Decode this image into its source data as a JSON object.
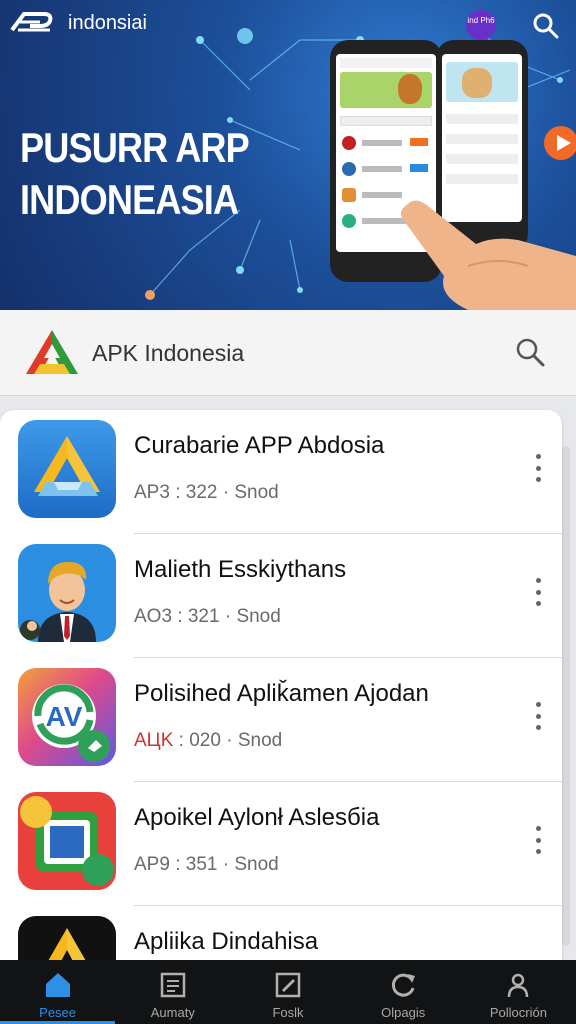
{
  "hero": {
    "brand_name": "indonsiai",
    "badge_text": "ind Ph6",
    "title_line1": "PUSURR ARP",
    "title_line2": "INDONEASIA"
  },
  "search": {
    "placeholder": "APK Indonesia"
  },
  "apps": [
    {
      "title": "Curabarie APP Abdosia",
      "meta": "AP3 : 322 · Snod",
      "icon": "drive-triangle-icon"
    },
    {
      "title": "Malieth Esskiythans",
      "meta": "AO3 : 321 · Snod",
      "icon": "businessman-avatar-icon"
    },
    {
      "title": "Polisihed Apliǩamen Ajodan",
      "meta_accent": "AЦK",
      "meta_rest": " : 020 · Snod",
      "icon": "refresh-badge-icon"
    },
    {
      "title": "Apoikel Aylonł Aslesбia",
      "meta": "AP9 : 351 · Snod",
      "icon": "square-frame-icon"
    },
    {
      "title": "Apliika Dindahisa",
      "icon": "drive-triangle-icon"
    }
  ],
  "nav": [
    {
      "label": "Pesee",
      "icon": "home-icon",
      "active": true
    },
    {
      "label": "Aumaty",
      "icon": "document-icon",
      "active": false
    },
    {
      "label": "Foslk",
      "icon": "edit-icon",
      "active": false
    },
    {
      "label": "Olpagis",
      "icon": "refresh-icon",
      "active": false
    },
    {
      "label": "Pollocrión",
      "icon": "user-icon",
      "active": false
    }
  ],
  "colors": {
    "accent": "#2e8fe6",
    "hero_dark": "#14306a",
    "nav_bg": "#121314",
    "meta_accent": "#d4322c"
  }
}
